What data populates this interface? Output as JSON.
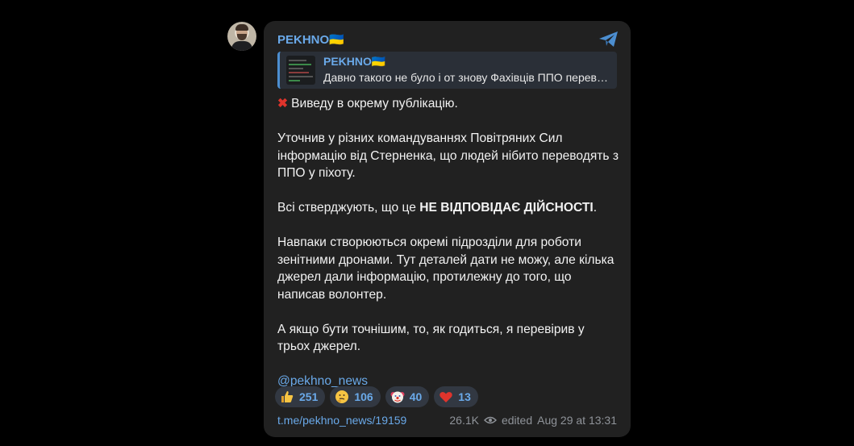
{
  "post": {
    "sender": "PEKHNO🇺🇦",
    "reply": {
      "title": "PEKHNO🇺🇦",
      "text": "Давно такого не було і от знову Фахівців ППО перев…"
    },
    "paragraphs": {
      "p1": "Виведу в окрему публікацію.",
      "p2": "Уточнив у різних командуваннях Повітряних Сил інформацію від Стерненка, що людей нібито переводять з ППО у піхоту.",
      "p3_before": "Всі стверджують, що це ",
      "p3_bold": "НЕ ВІДПОВІДАЄ ДІЙСНОСТІ",
      "p3_after": ".",
      "p4": "Навпаки створюються окремі підрозділи для роботи зенітними дронами. Тут деталей дати не можу, але кілька джерел дали інформацію, протилежну до того, що написав волонтер.",
      "p5": "А якщо бути точнішим, то, як годиться, я перевірив у трьох джерел.",
      "mention": "@pekhno_news"
    },
    "reactions": [
      {
        "emoji": "thumbs-up",
        "count": "251"
      },
      {
        "emoji": "thinking-face",
        "count": "106"
      },
      {
        "emoji": "clown-face",
        "count": "40"
      },
      {
        "emoji": "red-heart",
        "count": "13"
      }
    ],
    "footer": {
      "link": "t.me/pekhno_news/19159",
      "views": "26.1K",
      "status": "edited",
      "timestamp": "Aug 29 at 13:31"
    }
  },
  "colors": {
    "background": "#000000",
    "bubble": "#212121",
    "accent": "#6aa9e9",
    "reaction_bg": "#323842",
    "meta": "#8f9399"
  }
}
